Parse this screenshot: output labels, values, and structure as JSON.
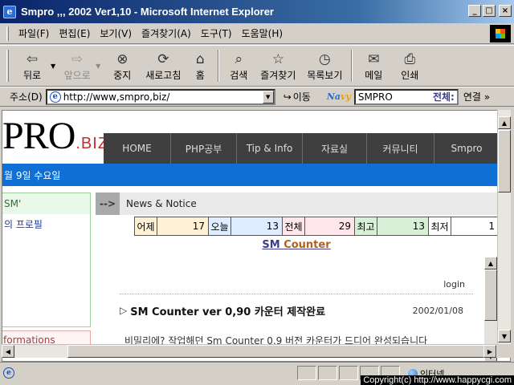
{
  "window": {
    "title": "Smpro ,,, 2002 Ver1,10 - Microsoft Internet Explorer",
    "minimize": "_",
    "maximize": "□",
    "close": "×"
  },
  "menu": [
    "파일(F)",
    "편집(E)",
    "보기(V)",
    "즐겨찾기(A)",
    "도구(T)",
    "도움말(H)"
  ],
  "toolbar": {
    "back": "뒤로",
    "forward": "앞으로",
    "stop": "중지",
    "refresh": "새로고침",
    "home": "홈",
    "search": "검색",
    "favorites": "즐겨찾기",
    "history": "목록보기",
    "mail": "메일",
    "print": "인쇄"
  },
  "address": {
    "label": "주소(D)",
    "url": "http://www,smpro,biz/",
    "go": "이동",
    "search_logo_a": "Na",
    "search_logo_b": "vy",
    "search_value": "SMPRO",
    "search_scope": "전체:",
    "links": "연결 »"
  },
  "site": {
    "logo_main": "PRO",
    "logo_suffix": ".BIZ",
    "nav": [
      "HOME",
      "PHP공부",
      "Tip & Info",
      "자료실",
      "커뮤니티",
      "Smpro"
    ],
    "date": "월 9일 수요일",
    "left_head": "SM'",
    "left_link": "의 프로필",
    "left_info": "formations",
    "news_arrow": "-->",
    "news_title": "News & Notice",
    "counter": [
      {
        "label": "어제",
        "value": "17",
        "bg": "#fff1d6"
      },
      {
        "label": "오늘",
        "value": "13",
        "bg": "#e0ecff"
      },
      {
        "label": "전체",
        "value": "29",
        "bg": "#ffe6ea"
      },
      {
        "label": "최고",
        "value": "13",
        "bg": "#d8f0d8"
      },
      {
        "label": "최저",
        "value": "1",
        "bg": "#ffffff"
      }
    ],
    "counter_title_a": "SM ",
    "counter_title_b": "Counter",
    "login": "login",
    "post_bullet": "▷",
    "post_title": "SM Counter ver 0,90 카운터 제작완료",
    "post_date": "2002/01/08",
    "post_body": "비밀리에? 작업해던 Sm Counter 0,9 버전 카운터가 드디어 완성되습니다"
  },
  "status": {
    "zone": "인터넷",
    "copyright": "Copyright(c) http://www.happycgi.com"
  },
  "colors": {
    "titlebar": "#0a246a",
    "datebar": "#0f6fd4",
    "nav": "#3f3f3f"
  }
}
